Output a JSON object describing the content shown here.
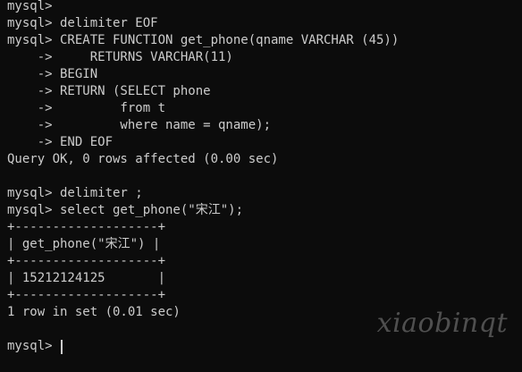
{
  "terminal": {
    "lines": [
      "mysql>",
      "mysql> delimiter EOF",
      "mysql> CREATE FUNCTION get_phone(qname VARCHAR (45))",
      "    ->     RETURNS VARCHAR(11)",
      "    -> BEGIN",
      "    -> RETURN (SELECT phone",
      "    ->         from t",
      "    ->         where name = qname);",
      "    -> END EOF",
      "Query OK, 0 rows affected (0.00 sec)",
      "",
      "mysql> delimiter ;",
      "mysql> select get_phone(\"宋江\");",
      "+-------------------+",
      "| get_phone(\"宋江\") |",
      "+-------------------+",
      "| 15212124125       |",
      "+-------------------+",
      "1 row in set (0.01 sec)",
      ""
    ],
    "prompt": "mysql> "
  },
  "watermark": "xiaobinqt",
  "colors": {
    "background": "#0c0c0c",
    "text": "#cccccc"
  }
}
